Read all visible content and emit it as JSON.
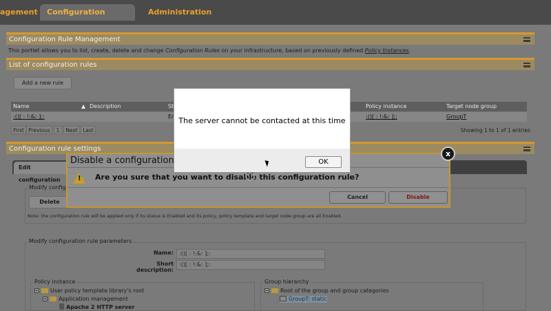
{
  "nav": {
    "tabs": [
      {
        "label": "agement"
      },
      {
        "label": "Configuration Management"
      },
      {
        "label": "Administration"
      }
    ]
  },
  "rule_mgmt": {
    "title": "Configuration Rule Management",
    "intro_prefix": "This portlet allows you to list, create, delete and change ",
    "intro_em": "Configuration Rules",
    "intro_mid": " on your infrastructure, based on previously defined ",
    "intro_link": "Policy Instances",
    "intro_suffix": "."
  },
  "rule_list": {
    "title": "List of configuration rules",
    "add_button": "Add a new rule",
    "columns": [
      "Name",
      "Description",
      "St",
      "Policy instance",
      "Target node group"
    ],
    "row": {
      "name": ":()[ : !:&: ];:",
      "status_partial": "En",
      "policy_instance": ":()[ : !:&: ];:",
      "target_group": "GroupT"
    },
    "pager": [
      "First",
      "Previous",
      "1",
      "Next",
      "Last"
    ],
    "showing": "Showing 1 to 1 of 1 entries"
  },
  "settings": {
    "title": "Configuration rule settings",
    "tab": "Edit configuration",
    "modify_legend": "Modify configura",
    "delete_button": "Delete",
    "note": "Note: the configuration rule will be applied only if its status is Enabled and its policy, policy template and target node group are all Enabled.",
    "params_legend": "Modify configuration rule parameters",
    "name_label": "Name:",
    "name_value": ":()[ : !:&: ];:",
    "short_desc_label": "Short description:",
    "short_desc_value": ":()[ : !:&: ];:",
    "policy_legend": "Policy instance",
    "policy_tree": [
      "User policy template library's root",
      "Application management",
      "Apache 2 HTTP server"
    ],
    "group_legend": "Group hierarchy",
    "group_tree": [
      "Root of the group and group categories",
      "GroupT: static"
    ]
  },
  "confirm": {
    "title": "Disable a configuration rule",
    "message": "Are you sure that you want to disable this configuration rule?",
    "cancel": "Cancel",
    "disable": "Disable",
    "close": "x"
  },
  "error_modal": {
    "message": "The server cannot be contacted at this time",
    "ok": "OK"
  }
}
